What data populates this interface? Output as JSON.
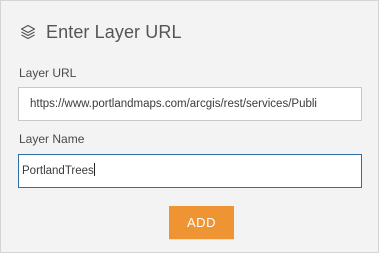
{
  "dialog": {
    "title": "Enter Layer URL",
    "title_icon": "layers-icon",
    "url_field": {
      "label": "Layer URL",
      "value": "https://www.portlandmaps.com/arcgis/rest/services/Publi"
    },
    "name_field": {
      "label": "Layer Name",
      "value": "PortlandTrees"
    },
    "add_button_label": "ADD"
  },
  "colors": {
    "panel_background": "#f3f3f3",
    "accent_button": "#ee9433",
    "focused_border": "#2f6fa5"
  }
}
